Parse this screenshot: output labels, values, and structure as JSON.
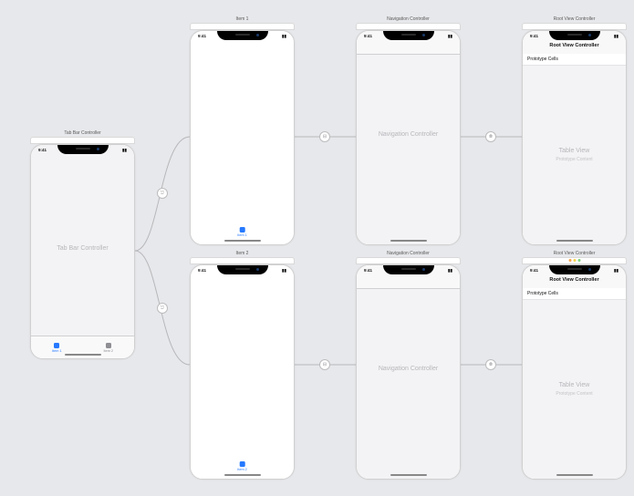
{
  "status_time": "9:41",
  "scenes": {
    "tabbar": {
      "title": "Tab Bar Controller",
      "placeholder": "Tab Bar Controller",
      "tabs": [
        {
          "label": "Item 1"
        },
        {
          "label": "Item 2"
        }
      ]
    },
    "item1": {
      "title": "Item 1",
      "tab_label": "Item 1"
    },
    "item2": {
      "title": "Item 2",
      "tab_label": "Item 2"
    },
    "nav1": {
      "title": "Navigation Controller",
      "placeholder": "Navigation Controller"
    },
    "nav2": {
      "title": "Navigation Controller",
      "placeholder": "Navigation Controller"
    },
    "root1": {
      "title": "Root View Controller",
      "nav_title": "Root View Controller",
      "proto_cells": "Prototype Cells",
      "table_label": "Table View",
      "table_sub": "Prototype Content"
    },
    "root2": {
      "title": "Root View Controller",
      "nav_title": "Root View Controller",
      "proto_cells": "Prototype Cells",
      "table_label": "Table View",
      "table_sub": "Prototype Content"
    }
  }
}
